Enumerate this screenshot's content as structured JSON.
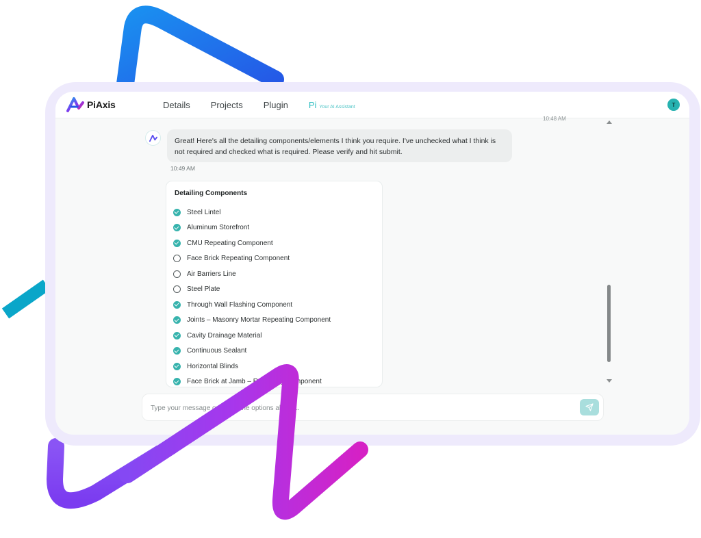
{
  "brand": {
    "name": "PiAxis"
  },
  "nav": {
    "items": [
      "Details",
      "Projects",
      "Plugin"
    ],
    "pi_label": "Pi",
    "pi_sub": "Your AI Assistant"
  },
  "user": {
    "initial": "T"
  },
  "chat": {
    "prev_time": "10:48 AM",
    "message": "Great! Here's all the detailing components/elements I think you require. I've unchecked what I think is not required and checked what is required. Please verify and hit submit.",
    "time": "10:49 AM"
  },
  "components": {
    "title": "Detailing Components",
    "items": [
      {
        "label": "Steel Lintel",
        "checked": true
      },
      {
        "label": "Aluminum Storefront",
        "checked": true
      },
      {
        "label": "CMU Repeating Component",
        "checked": true
      },
      {
        "label": "Face Brick Repeating Component",
        "checked": false
      },
      {
        "label": "Air Barriers Line",
        "checked": false
      },
      {
        "label": "Steel Plate",
        "checked": false
      },
      {
        "label": "Through Wall Flashing Component",
        "checked": true
      },
      {
        "label": "Joints – Masonry Mortar Repeating Component",
        "checked": true
      },
      {
        "label": "Cavity Drainage Material",
        "checked": true
      },
      {
        "label": "Continuous Sealant",
        "checked": true
      },
      {
        "label": "Horizontal Blinds",
        "checked": true
      },
      {
        "label": "Face Brick at Jamb – Repeating Component",
        "checked": true
      }
    ]
  },
  "input": {
    "placeholder": "Type your message or select the options above..."
  },
  "icons": {
    "send": "send-icon",
    "bot": "piaxis-logo-icon",
    "scroll_up": "chevron-up-icon",
    "scroll_down": "chevron-down-icon"
  },
  "colors": {
    "accent": "#37b3ad",
    "nav_active": "#2fbec1",
    "frame": "#eeeafc",
    "deco_blue": "#1f6fe5",
    "deco_cyan": "#0aa6c9",
    "deco_purple": "#9b3ff0",
    "deco_magenta": "#d21ec7"
  }
}
